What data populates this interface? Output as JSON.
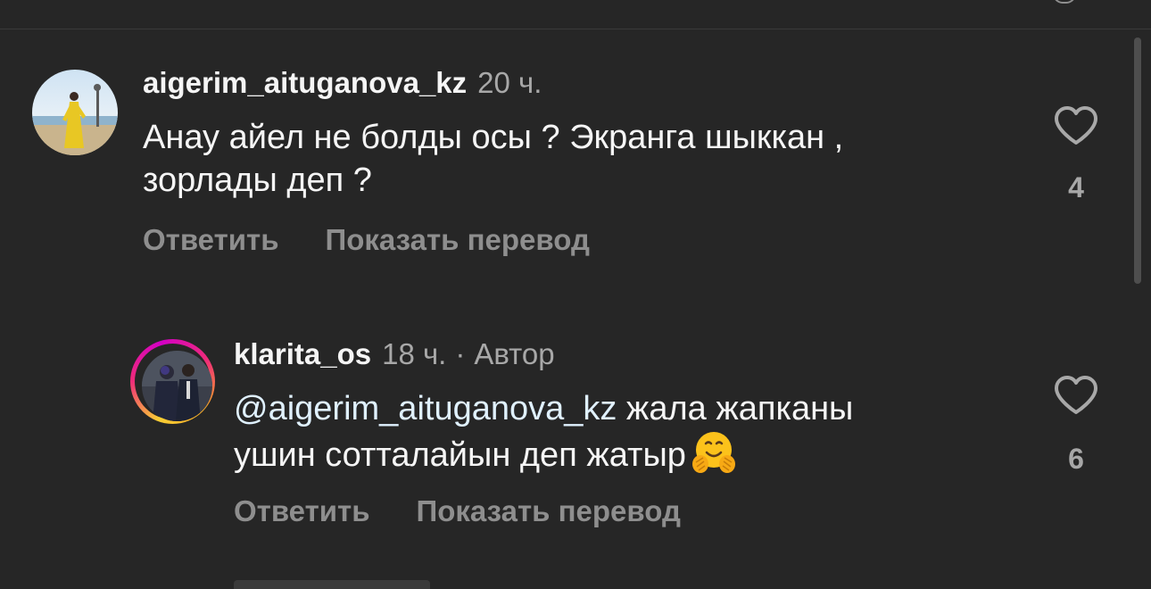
{
  "comments": [
    {
      "username": "aigerim_aituganova_kz",
      "time": "20 ч.",
      "text_line1": "Анау айел не болды осы ? Экранга шыккан ,",
      "text_line2": "зорлады деп ?",
      "reply_label": "Ответить",
      "translate_label": "Показать перевод",
      "like_icon": "heart-outline-icon",
      "like_count": "4",
      "avatar": "profile-photo-woman-yellow-dress"
    },
    {
      "username": "klarita_os",
      "time": "18 ч.",
      "separator": "·",
      "author_label": "Автор",
      "mention": "@aigerim_aituganova_kz",
      "text_after_mention": " жала жапканы",
      "text_line2": "ушин сотталайын деп жатыр",
      "emoji": "hugging-face-emoji",
      "reply_label": "Ответить",
      "translate_label": "Показать перевод",
      "like_icon": "heart-outline-icon",
      "like_count": "6",
      "avatar": "profile-photo-couple",
      "story_ring": true
    }
  ],
  "colors": {
    "background": "#262626",
    "primary_text": "#f5f5f5",
    "secondary_text": "#a8a8a8",
    "action_text": "#8e8e8e",
    "mention": "#e0f1ff"
  }
}
